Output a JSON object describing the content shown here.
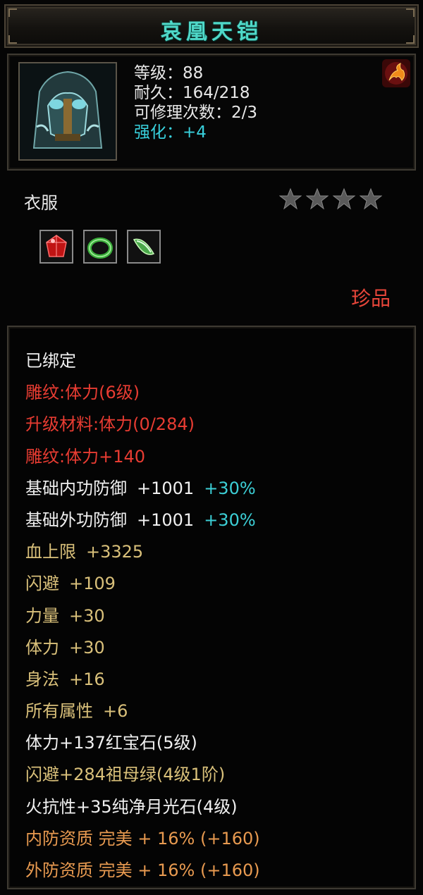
{
  "item": {
    "name": "哀凰天铠",
    "level": "等级：88",
    "durability": "耐久：164/218",
    "repair": "可修理次数：2/3",
    "enhance": "强化：+4",
    "type": "衣服",
    "stars": 4,
    "rarity": "珍品",
    "icon": "flame-icon",
    "gems": [
      {
        "name": "ruby-icon",
        "color": "#d01818"
      },
      {
        "name": "emerald-ring-icon",
        "color": "#3cae3c"
      },
      {
        "name": "moonstone-icon",
        "color": "#58c058"
      }
    ]
  },
  "attributes": {
    "bound": "已绑定",
    "engrave": "雕纹:体力(6级)",
    "upgrade": "升级材料:体力(0/284)",
    "engrave_bonus": "雕纹:体力+140",
    "inner_def": {
      "label": "基础内功防御",
      "value": "+1001",
      "bonus": "+30%"
    },
    "outer_def": {
      "label": "基础外功防御",
      "value": "+1001",
      "bonus": "+30%"
    },
    "hp": {
      "label": "血上限",
      "value": "+3325"
    },
    "dodge": {
      "label": "闪避",
      "value": "+109"
    },
    "strength": {
      "label": "力量",
      "value": "+30"
    },
    "stamina": {
      "label": "体力",
      "value": "+30"
    },
    "agility": {
      "label": "身法",
      "value": "+16"
    },
    "all": {
      "label": "所有属性",
      "value": "+6"
    },
    "gem1": "体力+137红宝石(5级)",
    "gem2": "闪避+284祖母绿(4级1阶)",
    "gem3": "火抗性+35纯净月光石(4级)",
    "inner_quality": "内防资质 完美 + 16% (+160)",
    "outer_quality": "外防资质 完美 + 16% (+160)"
  },
  "colors": {
    "title": "#4fd8c8",
    "red": "#e83c32",
    "gold": "#d9c07a",
    "orange": "#e89a50",
    "cyan": "#3ccfd6"
  }
}
